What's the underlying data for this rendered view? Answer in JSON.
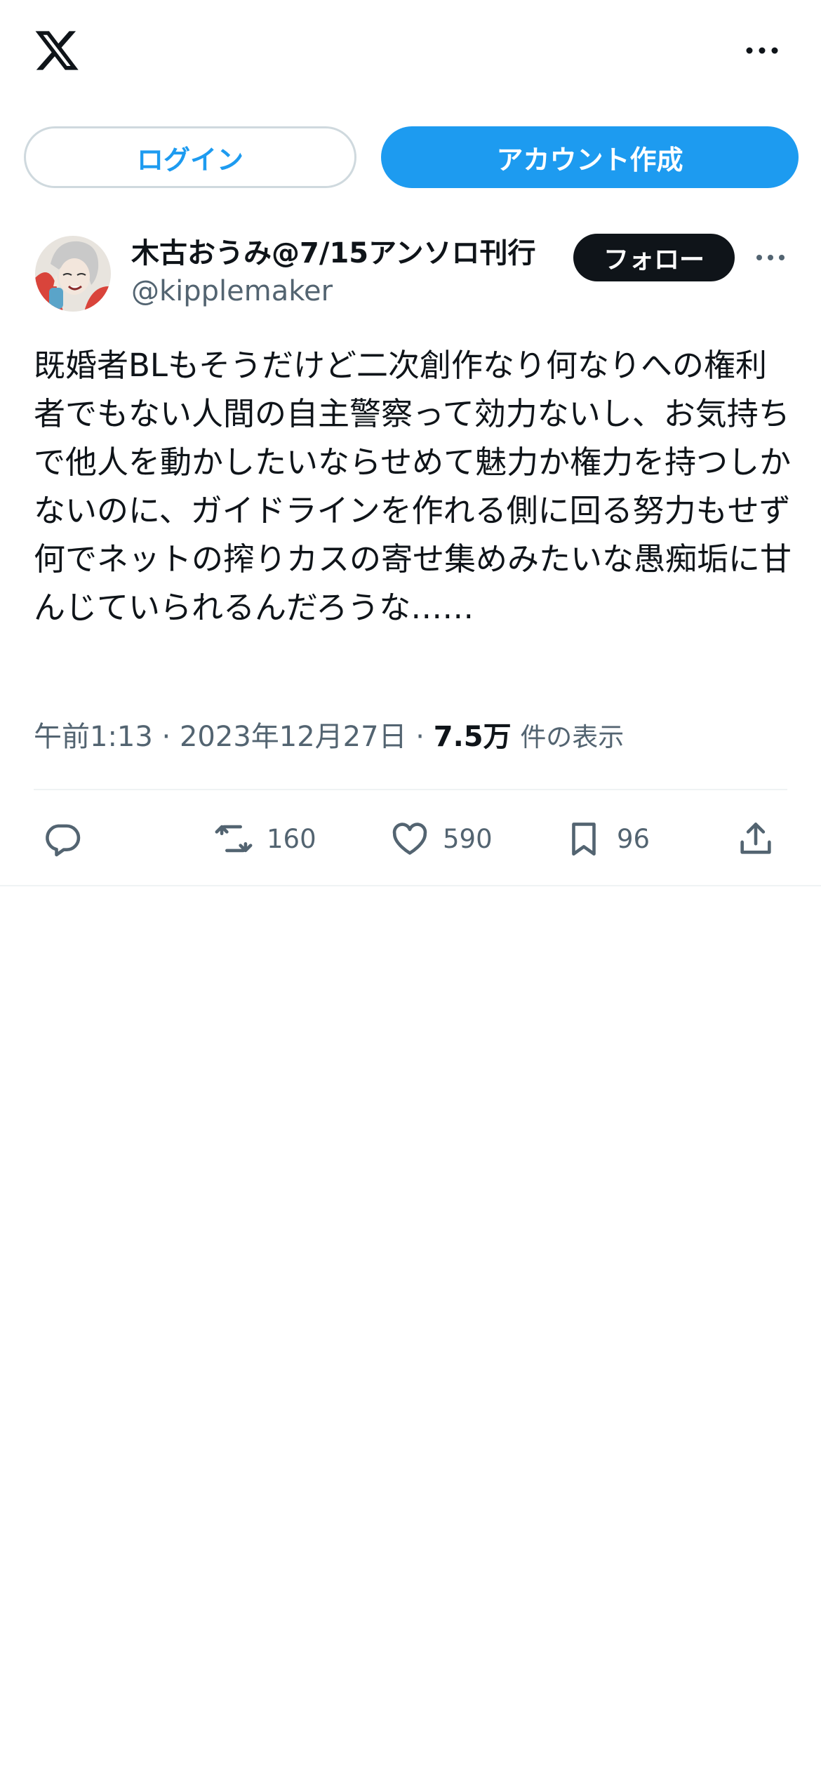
{
  "header": {
    "logo_icon": "x-logo-icon",
    "more_icon": "more-horizontal-icon"
  },
  "auth": {
    "login_label": "ログイン",
    "signup_label": "アカウント作成"
  },
  "tweet": {
    "display_name": "木古おうみ@7/15アンソロ刊行",
    "handle": "@kipplemaker",
    "follow_label": "フォロー",
    "text": "既婚者BLもそうだけど二次創作なり何なりへの権利者でもない人間の自主警察って効力ないし、お気持ちで他人を動かしたいならせめて魅力か権力を持つしかないのに、ガイドラインを作れる側に回る努力もせず何でネットの搾りカスの寄せ集めみたいな愚痴垢に甘んじていられるんだろうな……",
    "time": "午前1:13",
    "date": "2023年12月27日",
    "separator": "·",
    "views_count": "7.5万",
    "views_label": "件の表示"
  },
  "actions": {
    "reply_count": "",
    "retweet_count": "160",
    "like_count": "590",
    "bookmark_count": "96"
  },
  "colors": {
    "accent": "#1d9bf0",
    "text_primary": "#0f1419",
    "text_secondary": "#536471",
    "border": "#cfd9de"
  }
}
